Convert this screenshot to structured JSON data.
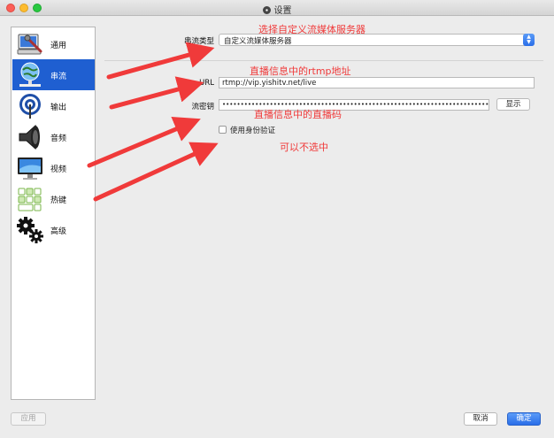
{
  "window": {
    "title": "设置"
  },
  "sidebar": {
    "items": [
      {
        "label": "通用",
        "icon": "computer-wrench-icon"
      },
      {
        "label": "串流",
        "icon": "globe-network-icon",
        "selected": true
      },
      {
        "label": "输出",
        "icon": "broadcast-signal-icon"
      },
      {
        "label": "音频",
        "icon": "speaker-icon"
      },
      {
        "label": "视频",
        "icon": "monitor-icon"
      },
      {
        "label": "热键",
        "icon": "keyboard-icon"
      },
      {
        "label": "高级",
        "icon": "gears-icon"
      }
    ]
  },
  "stream": {
    "type_label": "串流类型",
    "type_value": "自定义流媒体服务器",
    "url_label": "URL",
    "url_value": "rtmp://vip.yishitv.net/live",
    "key_label": "流密钥",
    "key_value": "••••••••••••••••••••••••••••••••••••••••••••••••••••••••••••••••••••••••••••••••••••••••••••••••",
    "show_button": "显示",
    "auth_label": "使用身份验证",
    "auth_checked": false
  },
  "annotations": {
    "a1": "选择自定义流媒体服务器",
    "a2": "直播信息中的rtmp地址",
    "a3": "直播信息中的直播码",
    "a4": "可以不选中",
    "color": "#f03a3a"
  },
  "footer": {
    "apply": "应用",
    "cancel": "取消",
    "ok": "确定"
  },
  "colors": {
    "accent": "#1f5fd1",
    "button_blue": "#2a6ee8"
  }
}
